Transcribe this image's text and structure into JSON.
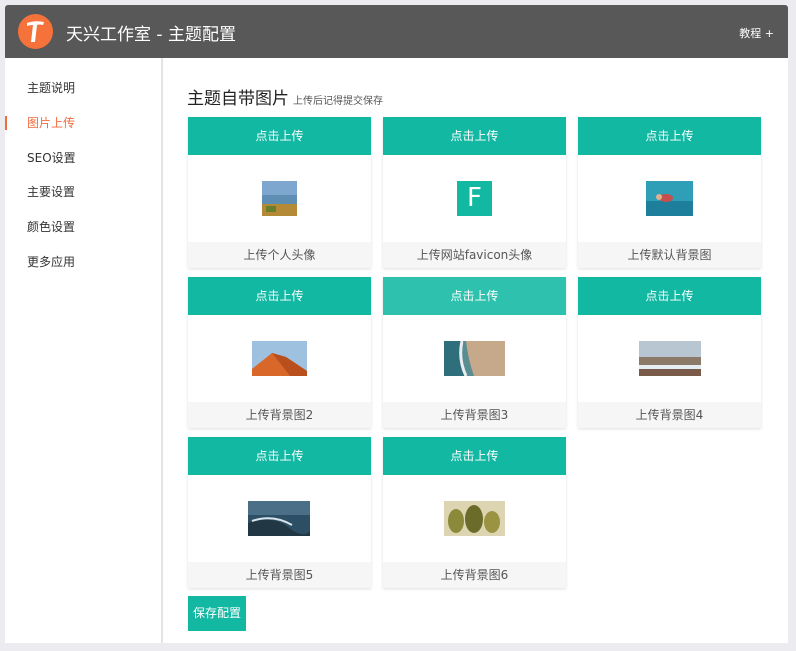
{
  "header": {
    "title": "天兴工作室 - 主题配置",
    "help_link": "教程 +"
  },
  "sidebar": {
    "items": [
      {
        "label": "主题说明",
        "active": false
      },
      {
        "label": "图片上传",
        "active": true
      },
      {
        "label": "SEO设置",
        "active": false
      },
      {
        "label": "主要设置",
        "active": false
      },
      {
        "label": "颜色设置",
        "active": false
      },
      {
        "label": "更多应用",
        "active": false
      }
    ]
  },
  "main": {
    "title": "主题自带图片",
    "subtitle": "上传后记得提交保存",
    "cards": [
      {
        "button": "点击上传",
        "caption": "上传个人头像"
      },
      {
        "button": "点击上传",
        "caption": "上传网站favicon头像",
        "thumb_letter": "F"
      },
      {
        "button": "点击上传",
        "caption": "上传默认背景图"
      },
      {
        "button": "点击上传",
        "caption": "上传背景图2"
      },
      {
        "button": "点击上传",
        "caption": "上传背景图3"
      },
      {
        "button": "点击上传",
        "caption": "上传背景图4"
      },
      {
        "button": "点击上传",
        "caption": "上传背景图5"
      },
      {
        "button": "点击上传",
        "caption": "上传背景图6"
      }
    ],
    "save_label": "保存配置"
  },
  "colors": {
    "accent": "#13b8a3",
    "active_nav": "#f06b3d",
    "header_bg": "#585858"
  }
}
